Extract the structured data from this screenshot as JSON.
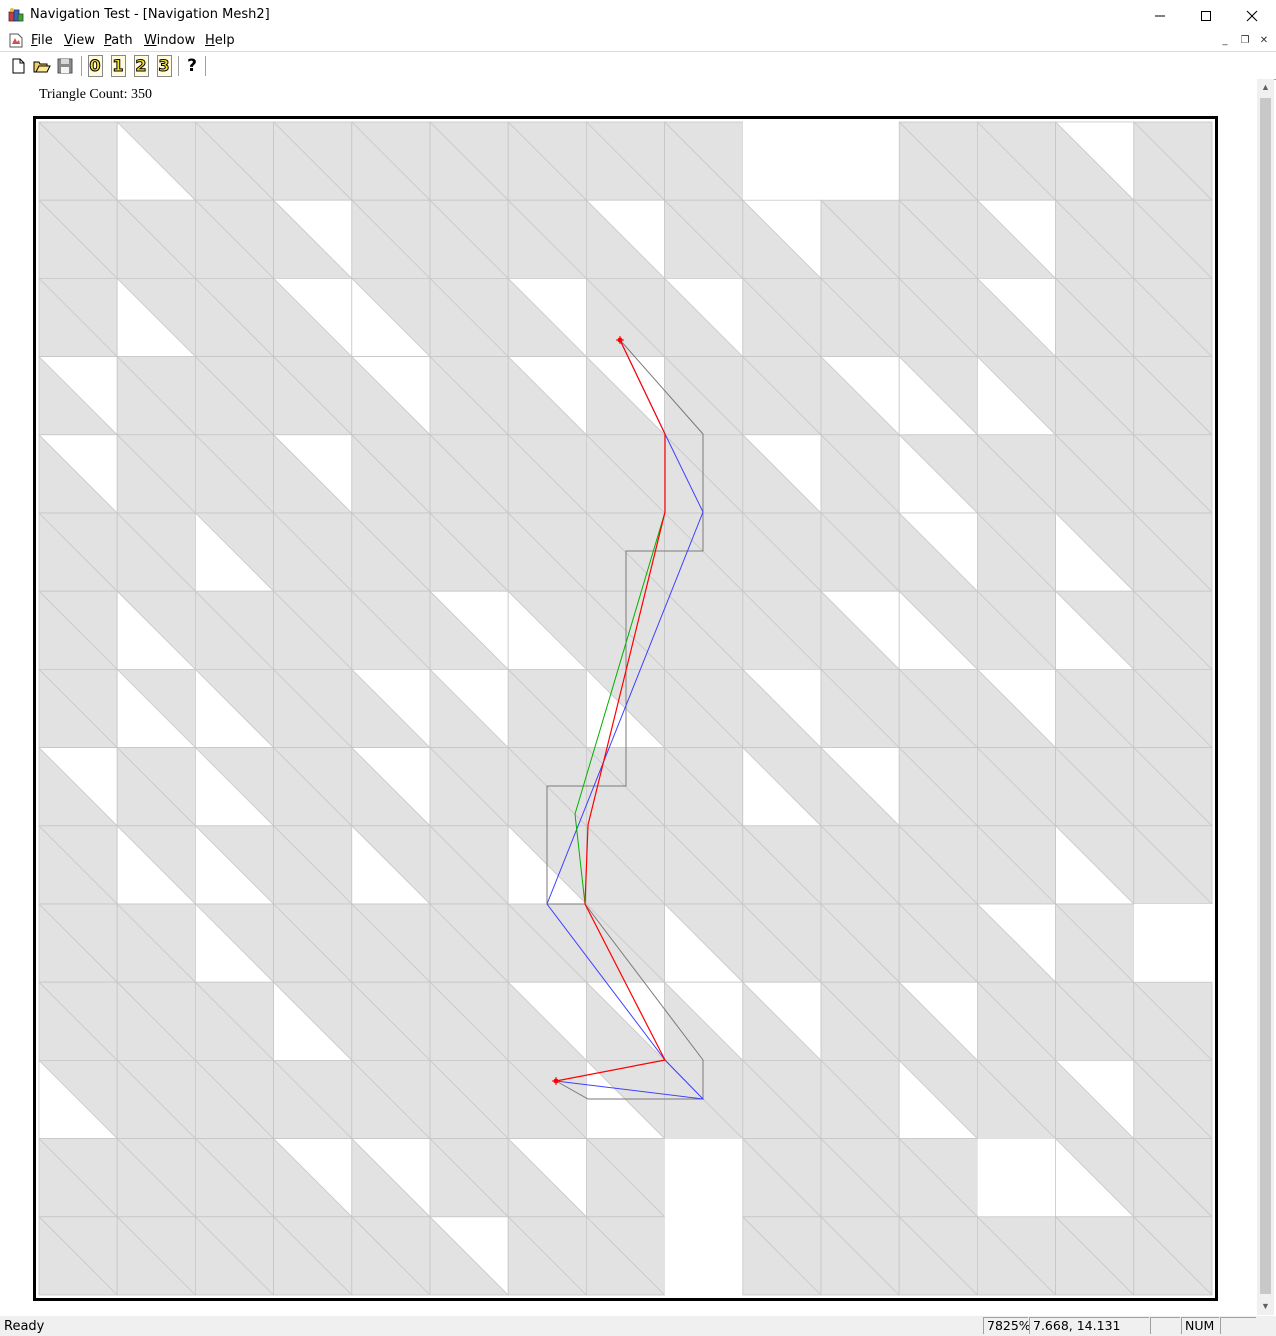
{
  "window": {
    "title": "Navigation Test - [Navigation Mesh2]",
    "minimize_glyph": "—",
    "maximize_glyph": "☐",
    "close_glyph": "✕"
  },
  "menu": {
    "items": [
      {
        "label": "File",
        "mnemonic": "F"
      },
      {
        "label": "View",
        "mnemonic": "V"
      },
      {
        "label": "Path",
        "mnemonic": "P"
      },
      {
        "label": "Window",
        "mnemonic": "W"
      },
      {
        "label": "Help",
        "mnemonic": "H"
      }
    ],
    "mdi": {
      "minimize": "_",
      "restore": "❐",
      "close": "✕"
    }
  },
  "toolbar": {
    "buttons": [
      {
        "name": "new-document-icon"
      },
      {
        "name": "open-folder-icon"
      },
      {
        "name": "save-disk-icon"
      }
    ],
    "number_buttons": [
      "0",
      "1",
      "2",
      "3"
    ],
    "help_label": "?"
  },
  "canvas": {
    "triangle_count_label": "Triangle Count: 350",
    "mesh_colors": {
      "fill": "#e2e2e2",
      "empty": "#ffffff",
      "grid_line": "#c6c6c6",
      "border": "#000000",
      "corridor": "#7a7a7a",
      "path_red": "#ff0000",
      "path_blue": "#4040ff",
      "path_green": "#00b000"
    }
  },
  "status": {
    "ready": "Ready",
    "zoom": "7825%",
    "coords": "7.668, 14.131",
    "num": "NUM"
  }
}
